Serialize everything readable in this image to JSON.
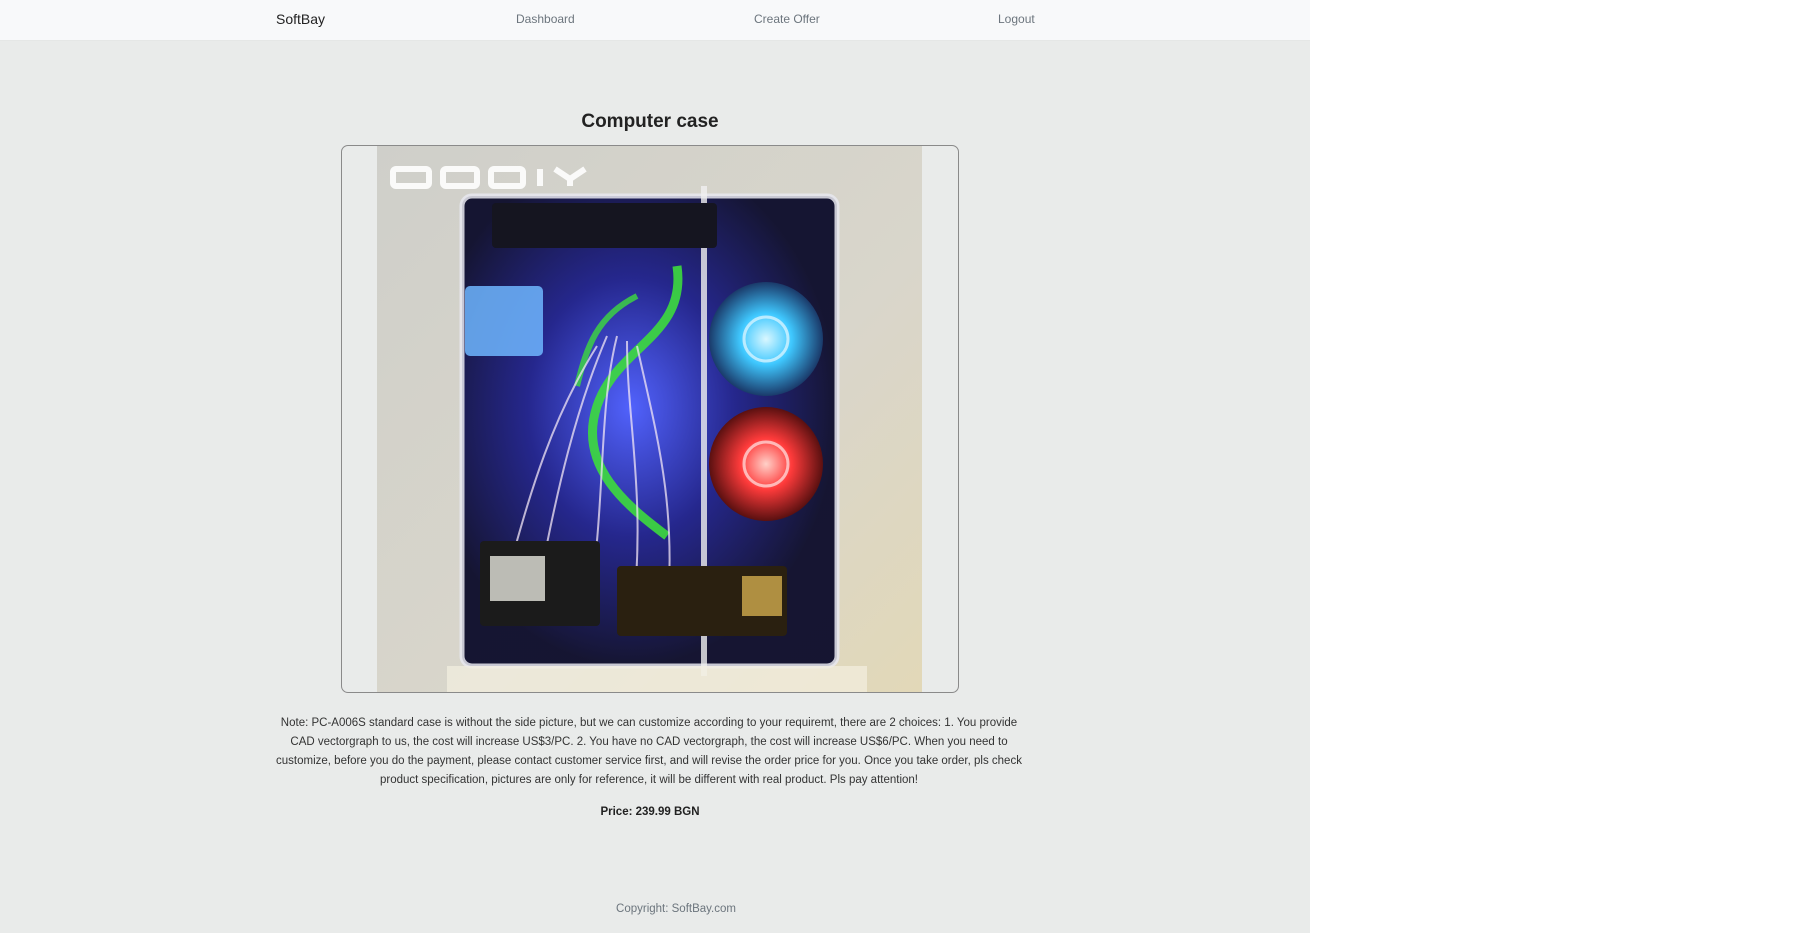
{
  "nav": {
    "brand": "SoftBay",
    "links": [
      "Dashboard",
      "Create Offer",
      "Logout"
    ]
  },
  "offer": {
    "title": "Computer case",
    "image": {
      "alt": "Computer case",
      "watermark": "QDIY"
    },
    "description": "Note: PC-A006S standard case is without the side picture, but we can customize according to your requiremt, there are 2 choices: 1. You provide CAD vectorgraph to us, the cost will increase US$3/PC. 2. You have no CAD vectorgraph, the cost will increase US$6/PC. When you need to customize, before you do the payment, please contact customer service first, and will revise the order price for you. Once you take order, pls check product specification, pictures are only for reference, it will be different with real product. Pls pay attention!",
    "price": "Price: 239.99 BGN"
  },
  "footer": {
    "copyright": "Copyright: SoftBay.com"
  },
  "colors": {
    "page_bg": "#e9ebea",
    "navbar_bg": "#f8f9fa",
    "nav_link": "#6c757d",
    "fan_blue": "#3fc8ff",
    "fan_red": "#ff3b3b",
    "tube_green": "#3ddc3d"
  }
}
